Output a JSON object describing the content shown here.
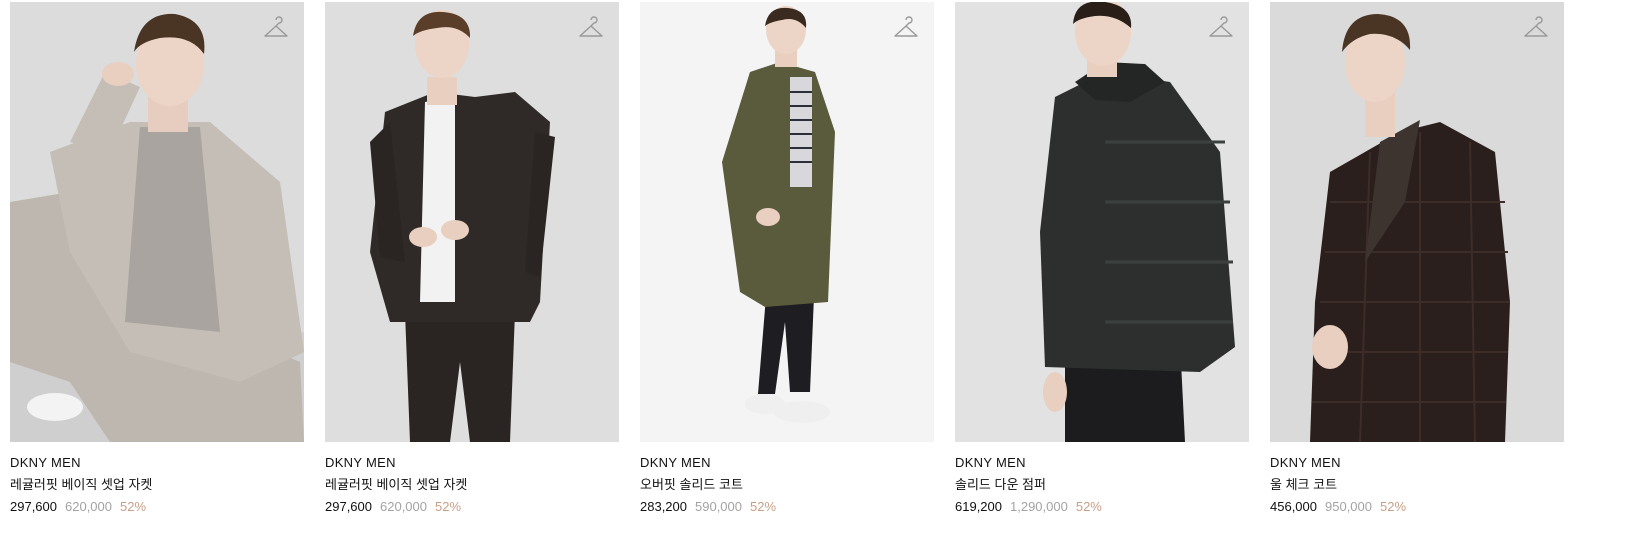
{
  "products": [
    {
      "brand": "DKNY MEN",
      "name": "레귤러핏 베이직 셋업 자켓",
      "sale_price": "297,600",
      "original_price": "620,000",
      "discount": "52%",
      "image": "model-seated-beige-suit",
      "bg_color": "#dcdcdc",
      "garment_color": "#c4beb6"
    },
    {
      "brand": "DKNY MEN",
      "name": "레귤러핏 베이직 셋업 자켓",
      "sale_price": "297,600",
      "original_price": "620,000",
      "discount": "52%",
      "image": "model-dark-brown-suit",
      "bg_color": "#dedede",
      "garment_color": "#2f2a27"
    },
    {
      "brand": "DKNY MEN",
      "name": "오버핏 솔리드 코트",
      "sale_price": "283,200",
      "original_price": "590,000",
      "discount": "52%",
      "image": "model-khaki-coat",
      "bg_color": "#f4f4f4",
      "garment_color": "#5a5a3c"
    },
    {
      "brand": "DKNY MEN",
      "name": "솔리드 다운 점퍼",
      "sale_price": "619,200",
      "original_price": "1,290,000",
      "discount": "52%",
      "image": "model-black-down-jacket",
      "bg_color": "#e2e2e2",
      "garment_color": "#2c2f2e"
    },
    {
      "brand": "DKNY MEN",
      "name": "울 체크 코트",
      "sale_price": "456,000",
      "original_price": "950,000",
      "discount": "52%",
      "image": "model-wool-check-coat",
      "bg_color": "#dadada",
      "garment_color": "#2a1f1c"
    }
  ],
  "icons": {
    "wishlist": "hanger-icon"
  },
  "colors": {
    "text": "#111111",
    "original_price": "#a3a3a3",
    "discount": "#c79f86"
  }
}
